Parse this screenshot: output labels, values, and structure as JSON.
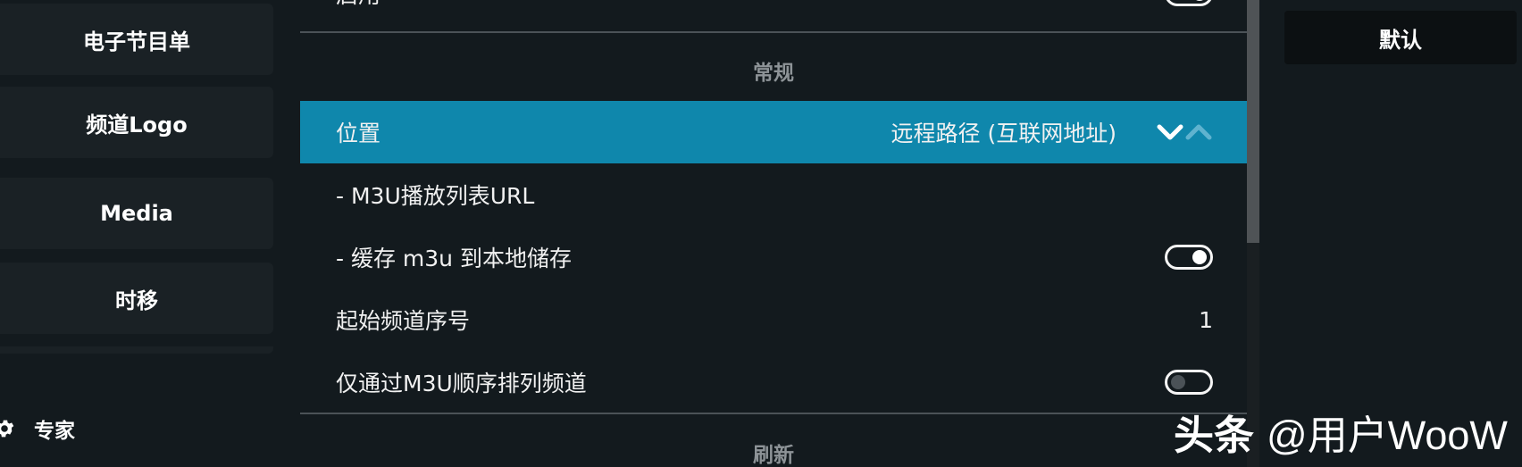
{
  "sidebar": {
    "items": [
      {
        "label": "电子节目单"
      },
      {
        "label": "频道Logo"
      },
      {
        "label": "Media"
      },
      {
        "label": "时移"
      }
    ],
    "expert_label": "专家",
    "expert_icon": "gear-icon"
  },
  "settings": {
    "top_row": {
      "label": "启用",
      "toggle": "on"
    },
    "sections": [
      {
        "title": "常规"
      },
      {
        "title": "刷新"
      }
    ],
    "rows": [
      {
        "label": "位置",
        "value": "远程路径 (互联网地址)",
        "control": "spinner"
      },
      {
        "label": "- M3U播放列表URL",
        "value": ""
      },
      {
        "label": "- 缓存 m3u 到本地储存",
        "toggle": "on"
      },
      {
        "label": "起始频道序号",
        "value": "1"
      },
      {
        "label": "仅通过M3U顺序排列频道",
        "toggle": "off"
      }
    ]
  },
  "actions": {
    "default_label": "默认"
  },
  "watermark": {
    "brand": "头条",
    "text": "@用户WooW"
  },
  "colors": {
    "focus": "#0f87ac",
    "background": "#131a1e",
    "panel": "#1a2125"
  }
}
